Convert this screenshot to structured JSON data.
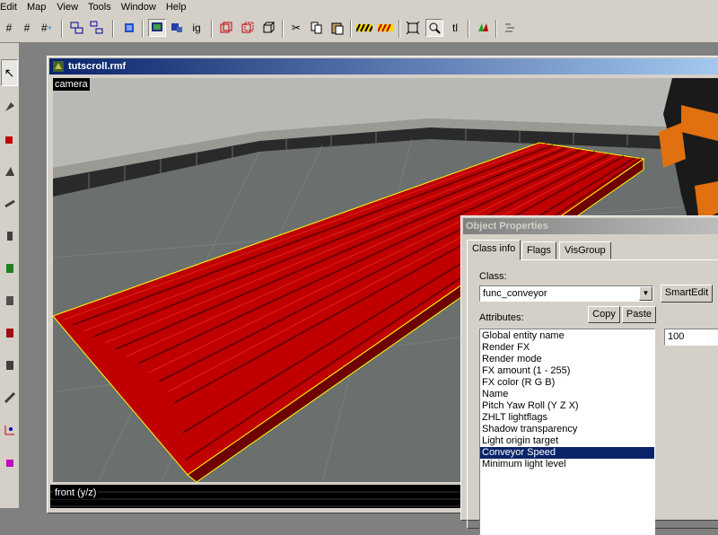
{
  "menu": [
    "Edit",
    "Map",
    "View",
    "Tools",
    "Window",
    "Help"
  ],
  "toolbar_icons": [
    "grid-icon",
    "grid-smaller-icon",
    "grid-larger-icon",
    "group-icon",
    "ungroup-icon",
    "texture-lock-icon",
    "selection-icon",
    "hide-icon",
    "ignore-groups-icon",
    "carve-icon",
    "hollow-icon",
    "cube-icon",
    "cut-icon",
    "copy-icon",
    "paste-icon",
    "toggle-texture-icon",
    "toggle-decal-icon",
    "box-select-icon",
    "zoom-icon",
    "texture-app-icon",
    "run-map-icon",
    "entity-report-icon"
  ],
  "toolbar_text": {
    "ignore_groups": "ig",
    "texture_label": "tl"
  },
  "document": {
    "title": "tutscroll.rmf"
  },
  "viewports": {
    "camera_label": "camera",
    "front_label": "front (y/z)"
  },
  "properties": {
    "title": "Object Properties",
    "tabs": [
      "Class info",
      "Flags",
      "VisGroup"
    ],
    "class_label": "Class:",
    "class_value": "func_conveyor",
    "smartedit_label": "SmartEdit",
    "attributes_label": "Attributes:",
    "copy_label": "Copy",
    "paste_label": "Paste",
    "attributes": [
      "Global entity name",
      "Render FX",
      "Render mode",
      "FX amount (1 - 255)",
      "FX color (R G B)",
      "Name",
      "Pitch Yaw Roll (Y Z X)",
      "ZHLT lightflags",
      "Shadow transparency",
      "Light origin target",
      "Conveyor Speed",
      "Minimum light level"
    ],
    "selected_attribute": "Conveyor Speed",
    "value": "100"
  },
  "colors": {
    "conveyor": "#c00000",
    "selection": "#0a246a",
    "outline": "#ffff00"
  }
}
